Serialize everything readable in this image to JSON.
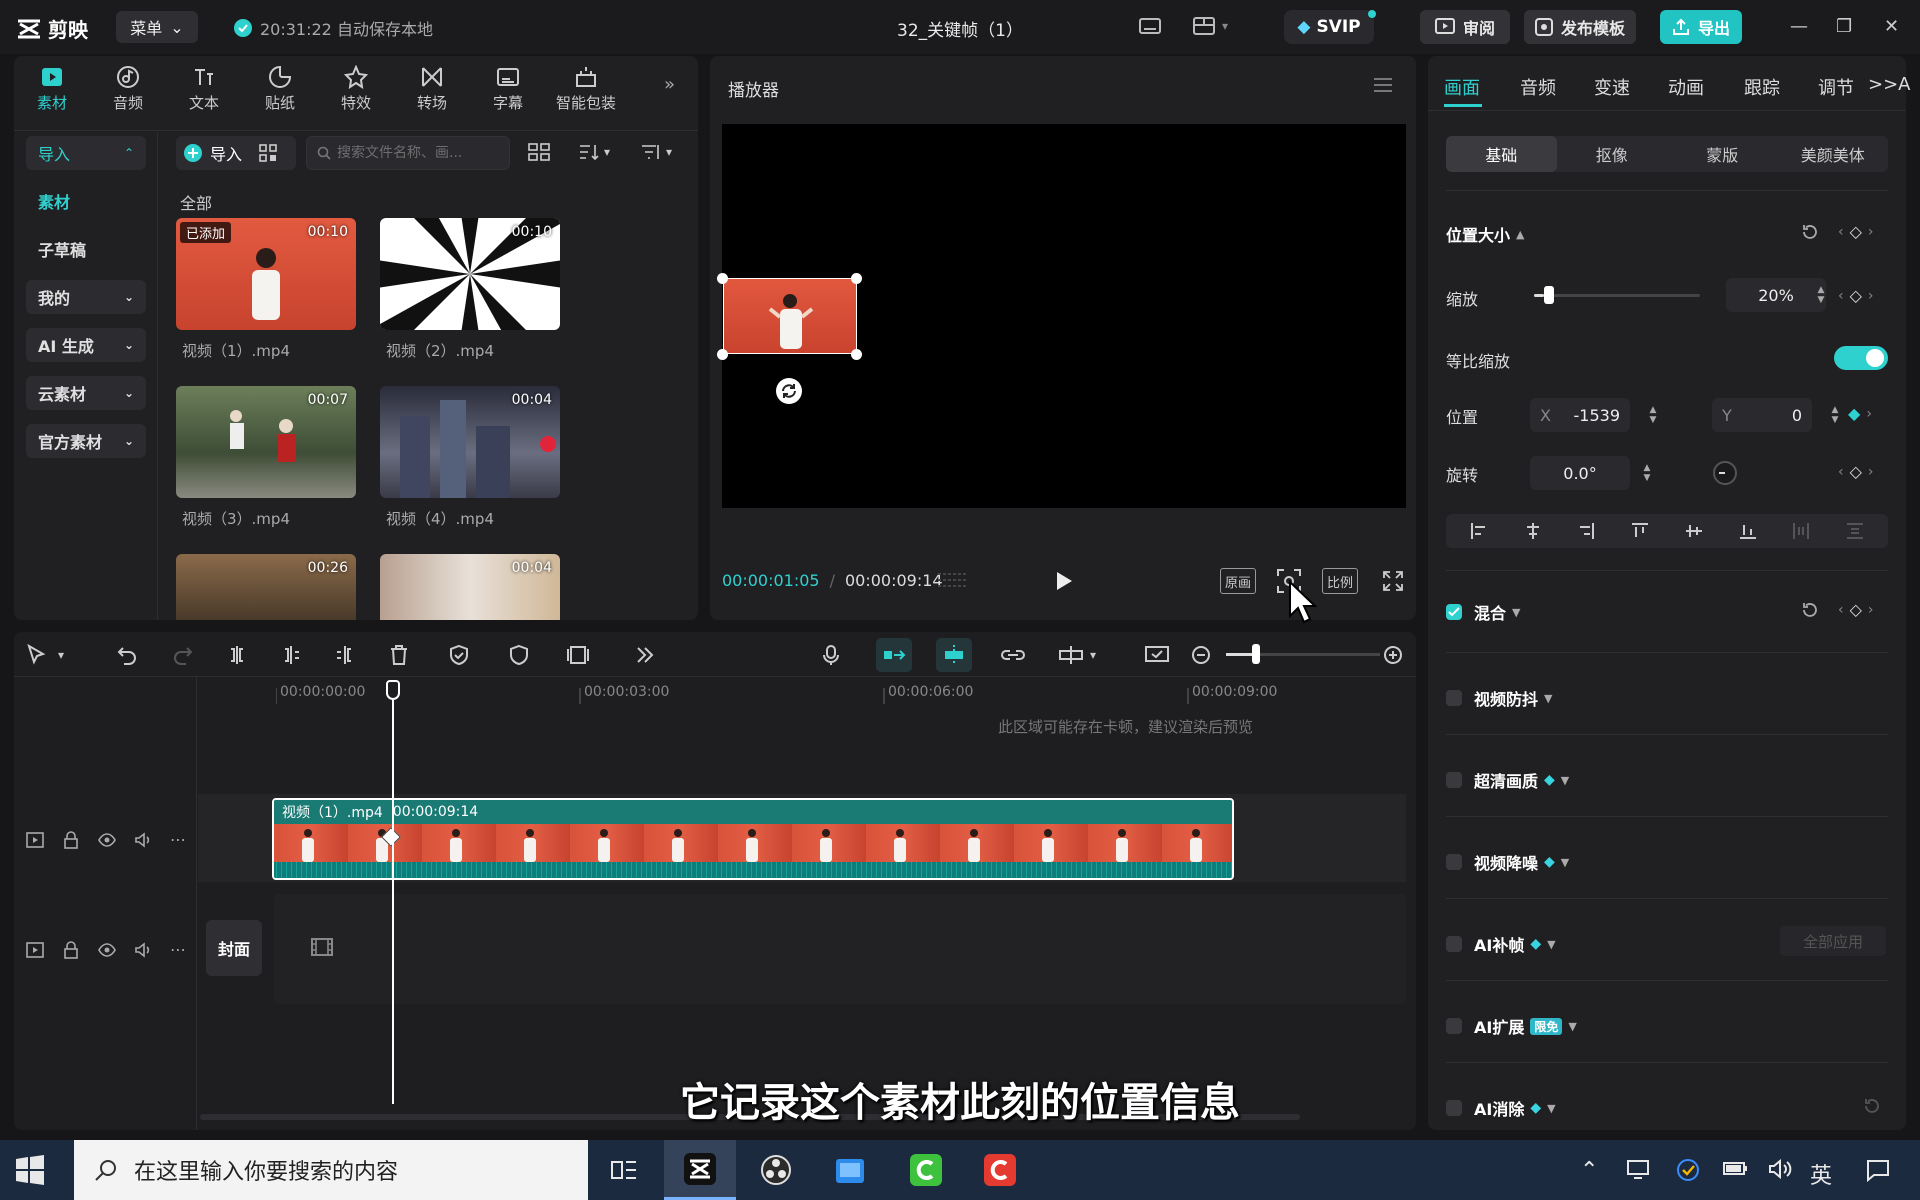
{
  "app": {
    "logo_text": "剪映",
    "menu_label": "菜单",
    "autosave": "20:31:22 自动保存本地",
    "project_title": "32_关键帧（1）",
    "svip_label": "SVIP",
    "review_label": "审阅",
    "publish_label": "发布模板",
    "export_label": "导出"
  },
  "media": {
    "tabs": [
      {
        "label": "素材",
        "icon": "media-icon"
      },
      {
        "label": "音频",
        "icon": "audio-icon"
      },
      {
        "label": "文本",
        "icon": "text-icon"
      },
      {
        "label": "贴纸",
        "icon": "sticker-icon"
      },
      {
        "label": "特效",
        "icon": "effects-icon"
      },
      {
        "label": "转场",
        "icon": "transition-icon"
      },
      {
        "label": "字幕",
        "icon": "caption-icon"
      },
      {
        "label": "智能包装",
        "icon": "smart-pack-icon"
      }
    ],
    "sidebar": [
      {
        "label": "导入"
      },
      {
        "label": "素材"
      },
      {
        "label": "子草稿"
      },
      {
        "label": "我的"
      },
      {
        "label": "AI 生成"
      },
      {
        "label": "云素材"
      },
      {
        "label": "官方素材"
      }
    ],
    "import_label": "导入",
    "search_placeholder": "搜索文件名称、画...",
    "all_label": "全部",
    "added_badge": "已添加",
    "items": [
      {
        "name": "视频（1）.mp4",
        "duration": "00:10"
      },
      {
        "name": "视频（2）.mp4",
        "duration": "00:10"
      },
      {
        "name": "视频（3）.mp4",
        "duration": "00:07"
      },
      {
        "name": "视频（4）.mp4",
        "duration": "00:04"
      },
      {
        "name": "",
        "duration": "00:26"
      },
      {
        "name": "",
        "duration": "00:04"
      }
    ]
  },
  "player": {
    "title": "播放器",
    "current_time": "00:00:01:05",
    "total_time": "00:00:09:14",
    "original_label": "原画",
    "ratio_label": "比例"
  },
  "props": {
    "tabs": [
      "画面",
      "音频",
      "变速",
      "动画",
      "跟踪",
      "调节",
      ">>A"
    ],
    "subtabs": [
      "基础",
      "抠像",
      "蒙版",
      "美颜美体"
    ],
    "position_size_title": "位置大小",
    "scale_label": "缩放",
    "scale_value": "20%",
    "scale_fraction": 0.2,
    "uniform_scale_label": "等比缩放",
    "position_label": "位置",
    "x_axis": "X",
    "x_value": "-1539",
    "y_axis": "Y",
    "y_value": "0",
    "rotation_label": "旋转",
    "rotation_value": "0.0°",
    "blend_label": "混合",
    "features": [
      {
        "label": "视频防抖",
        "vip": false,
        "free": ""
      },
      {
        "label": "超清画质",
        "vip": true,
        "free": ""
      },
      {
        "label": "视频降噪",
        "vip": true,
        "free": ""
      },
      {
        "label": "AI补帧",
        "vip": true,
        "free": ""
      },
      {
        "label": "AI扩展",
        "vip": false,
        "free": "限免"
      },
      {
        "label": "AI消除",
        "vip": true,
        "free": ""
      }
    ],
    "apply_all_label": "全部应用"
  },
  "timeline": {
    "ruler": [
      "00:00:00:00",
      "00:00:03:00",
      "00:00:06:00",
      "00:00:09:00"
    ],
    "warning": "此区域可能存在卡顿，建议渲染后预览",
    "clip_name": "视频（1）.mp4",
    "clip_duration": "00:00:09:14",
    "cover_label": "封面"
  },
  "subtitle_text": "它记录这个素材此刻的位置信息",
  "taskbar": {
    "search_placeholder": "在这里输入你要搜索的内容",
    "ime_label": "英"
  },
  "colors": {
    "accent": "#2fd1cf",
    "clip_teal": "#1a7a74",
    "clip_red": "#d9523a",
    "panel_bg": "#202023"
  }
}
